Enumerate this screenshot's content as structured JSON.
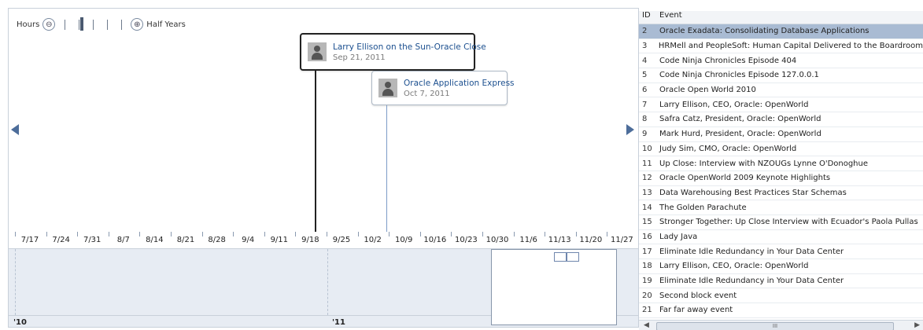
{
  "zoom": {
    "left_label": "Hours",
    "right_label": "Half Years",
    "zoom_out_icon": "minus-circle-icon",
    "zoom_in_icon": "plus-circle-icon"
  },
  "events": [
    {
      "title": "Larry Ellison on the Sun-Oracle Close",
      "date": "Sep 21, 2011",
      "selected": true
    },
    {
      "title": "Oracle Application Express",
      "date": "Oct 7, 2011",
      "selected": false
    }
  ],
  "axis_labels": [
    "7/17",
    "7/24",
    "7/31",
    "8/7",
    "8/14",
    "8/21",
    "8/28",
    "9/4",
    "9/11",
    "9/18",
    "9/25",
    "10/2",
    "10/9",
    "10/16",
    "10/23",
    "10/30",
    "11/6",
    "11/13",
    "11/20",
    "11/27"
  ],
  "overview": {
    "years": [
      "'10",
      "'11"
    ]
  },
  "table": {
    "header": {
      "id": "ID",
      "event": "Event"
    },
    "rows": [
      {
        "id": "2",
        "event": "Oracle Exadata: Consolidating Database Applications",
        "selected": true
      },
      {
        "id": "3",
        "event": "HRMell and PeopleSoft: Human Capital Delivered to the Boardroom"
      },
      {
        "id": "4",
        "event": "Code Ninja Chronicles Episode 404"
      },
      {
        "id": "5",
        "event": "Code Ninja Chronicles Episode 127.0.0.1"
      },
      {
        "id": "6",
        "event": "Oracle Open World 2010"
      },
      {
        "id": "7",
        "event": "Larry Ellison, CEO, Oracle: OpenWorld"
      },
      {
        "id": "8",
        "event": "Safra Catz, President, Oracle: OpenWorld"
      },
      {
        "id": "9",
        "event": "Mark Hurd, President, Oracle: OpenWorld"
      },
      {
        "id": "10",
        "event": "Judy Sim, CMO, Oracle: OpenWorld"
      },
      {
        "id": "11",
        "event": "Up Close: Interview with NZOUGs Lynne O'Donoghue"
      },
      {
        "id": "12",
        "event": "Oracle OpenWorld 2009 Keynote Highlights"
      },
      {
        "id": "13",
        "event": "Data Warehousing Best Practices Star Schemas"
      },
      {
        "id": "14",
        "event": "The Golden Parachute"
      },
      {
        "id": "15",
        "event": "Stronger Together: Up Close Interview with Ecuador's Paola Pullas"
      },
      {
        "id": "16",
        "event": "Lady Java"
      },
      {
        "id": "17",
        "event": "Eliminate Idle Redundancy in Your Data Center"
      },
      {
        "id": "18",
        "event": "Larry Ellison, CEO, Oracle: OpenWorld"
      },
      {
        "id": "19",
        "event": "Eliminate Idle Redundancy in Your Data Center"
      },
      {
        "id": "20",
        "event": "Second block event"
      },
      {
        "id": "21",
        "event": "Far far away event"
      }
    ],
    "scroll_grip": "III"
  },
  "colors": {
    "accent": "#1b4f8f",
    "selected_row": "#a9bbd3",
    "overview_bg": "#e7ecf3",
    "stem_selected": "#222222",
    "stem_normal": "#7d9cc7"
  }
}
